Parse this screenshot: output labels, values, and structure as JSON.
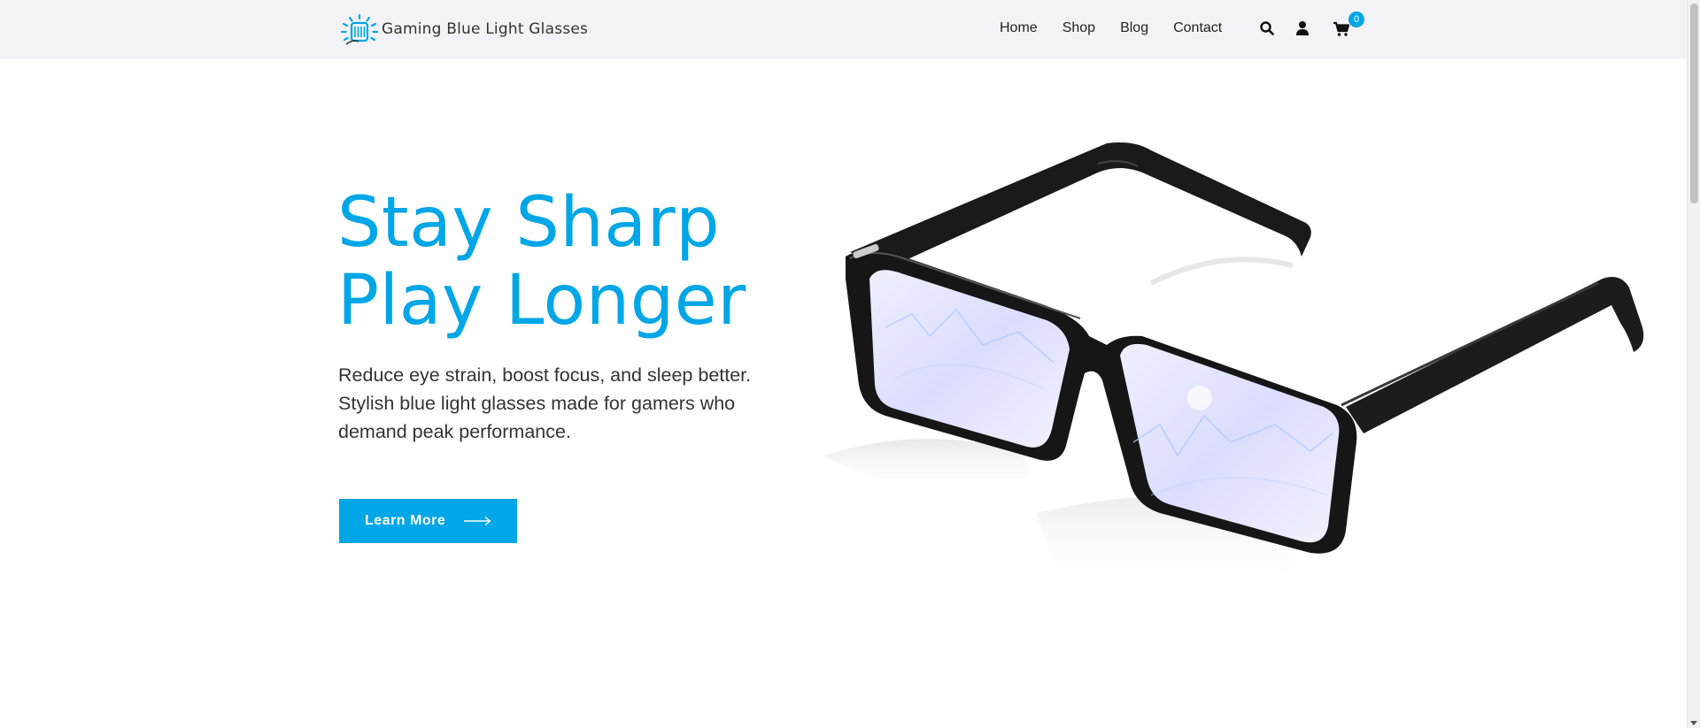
{
  "brand": {
    "name": "Gaming Blue Light Glasses",
    "accent": "#00a6e6"
  },
  "nav": {
    "items": [
      "Home",
      "Shop",
      "Blog",
      "Contact"
    ]
  },
  "header_icons": {
    "search": "search-icon",
    "account": "user-icon",
    "cart": "cart-icon",
    "cart_count": "0"
  },
  "hero": {
    "title_line1": "Stay Sharp",
    "title_line2": "Play Longer",
    "desc_line1": "Reduce eye strain, boost focus, and sleep better.",
    "desc_line2": "Stylish blue light glasses made for gamers who",
    "desc_line3": "demand peak performance.",
    "cta_label": "Learn More"
  }
}
